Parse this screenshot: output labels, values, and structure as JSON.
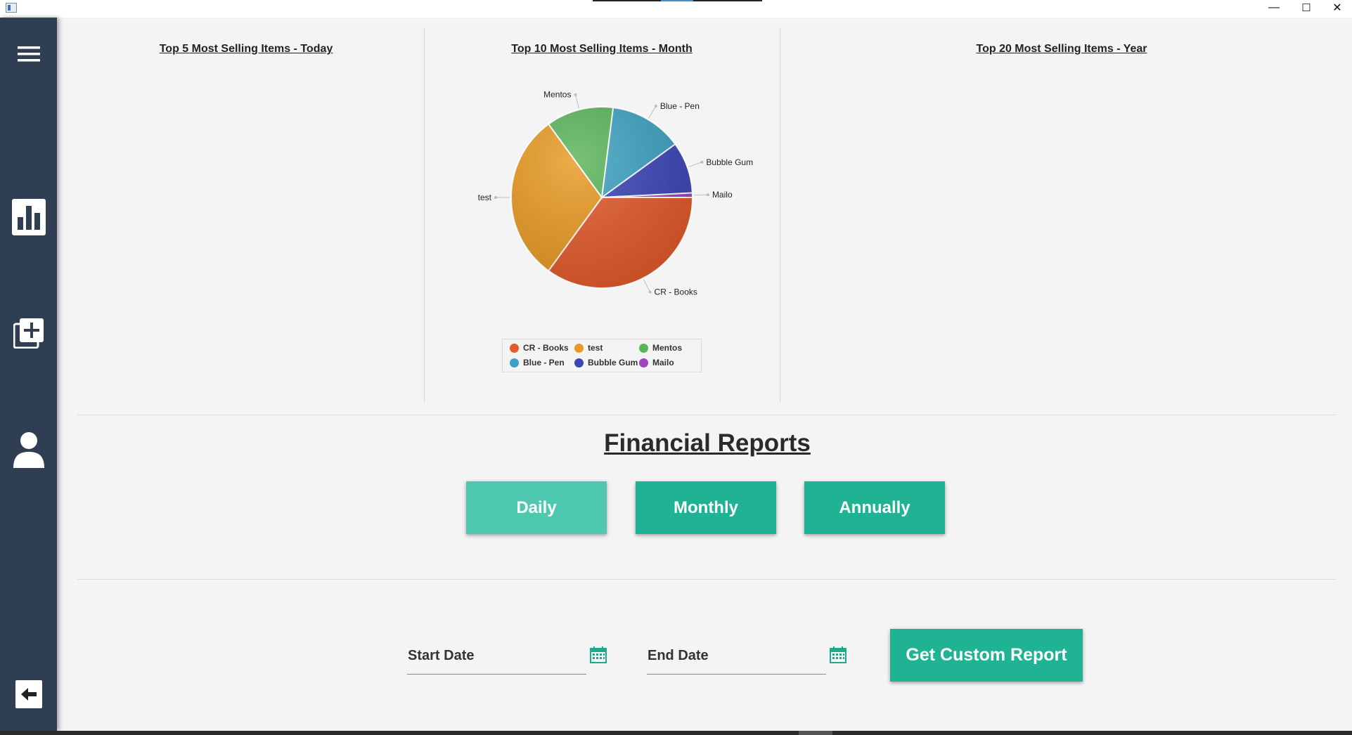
{
  "window": {
    "minimize": "—",
    "maximize": "☐",
    "close": "✕"
  },
  "sidebar": {
    "items": [
      {
        "name": "menu-icon"
      },
      {
        "name": "bar-chart-icon"
      },
      {
        "name": "add-item-icon"
      },
      {
        "name": "user-icon"
      },
      {
        "name": "back-arrow-icon"
      }
    ]
  },
  "charts": {
    "today_title": "Top 5 Most Selling Items - Today",
    "month_title": "Top 10 Most Selling Items - Month",
    "year_title": "Top 20 Most Selling Items - Year"
  },
  "chart_data": {
    "type": "pie",
    "title": "Top 10 Most Selling Items - Month",
    "series": [
      {
        "name": "CR - Books",
        "value": 35,
        "color": "#e35a2b"
      },
      {
        "name": "test",
        "value": 30,
        "color": "#e99a22"
      },
      {
        "name": "Mentos",
        "value": 12,
        "color": "#5ab55a"
      },
      {
        "name": "Blue - Pen",
        "value": 13,
        "color": "#3ea3c2"
      },
      {
        "name": "Bubble Gum",
        "value": 9.2,
        "color": "#3d46b8"
      },
      {
        "name": "Mailo",
        "value": 0.8,
        "color": "#a044c2"
      }
    ],
    "legend": "bottom"
  },
  "financial": {
    "title": "Financial Reports",
    "daily": "Daily",
    "monthly": "Monthly",
    "annually": "Annually"
  },
  "custom": {
    "start_date": "Start Date",
    "end_date": "End Date",
    "button": "Get Custom Report"
  },
  "colors": {
    "accent": "#1fb393",
    "accent_light": "#4ec9b0",
    "sidebar": "#2f3e52"
  }
}
